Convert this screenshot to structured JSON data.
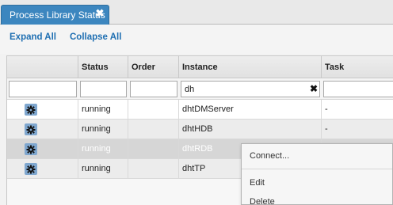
{
  "tab": {
    "title": "Process Library Status",
    "close": "✖"
  },
  "toolbar": {
    "expand_all": "Expand All",
    "collapse_all": "Collapse All"
  },
  "grid": {
    "columns": [
      "",
      "Status",
      "Order",
      "Instance",
      "Task"
    ],
    "filters": {
      "action": "",
      "status": "",
      "order": "",
      "instance": "dh",
      "task": ""
    },
    "clear_glyph": "✖",
    "rows": [
      {
        "status": "running",
        "order": "",
        "instance": "dhtDMServer",
        "task": "-"
      },
      {
        "status": "running",
        "order": "",
        "instance": "dhtHDB",
        "task": "-"
      },
      {
        "status": "running",
        "order": "",
        "instance": "dhtRDB",
        "task": ""
      },
      {
        "status": "running",
        "order": "",
        "instance": "dhtTP",
        "task": ""
      }
    ],
    "selected_row": 2
  },
  "context_menu": {
    "items": [
      {
        "label": "Connect..."
      },
      {
        "label": "Edit"
      },
      {
        "label": "Delete"
      }
    ]
  },
  "icons": {
    "row_action": "gear-icon",
    "tab_close": "close-icon",
    "filter_clear": "clear-icon"
  },
  "colors": {
    "tab_bg": "#3c86bf",
    "link": "#1f6fb2",
    "gear_bg": "#7fa7cf",
    "selected_row": "#d6d6d6"
  }
}
